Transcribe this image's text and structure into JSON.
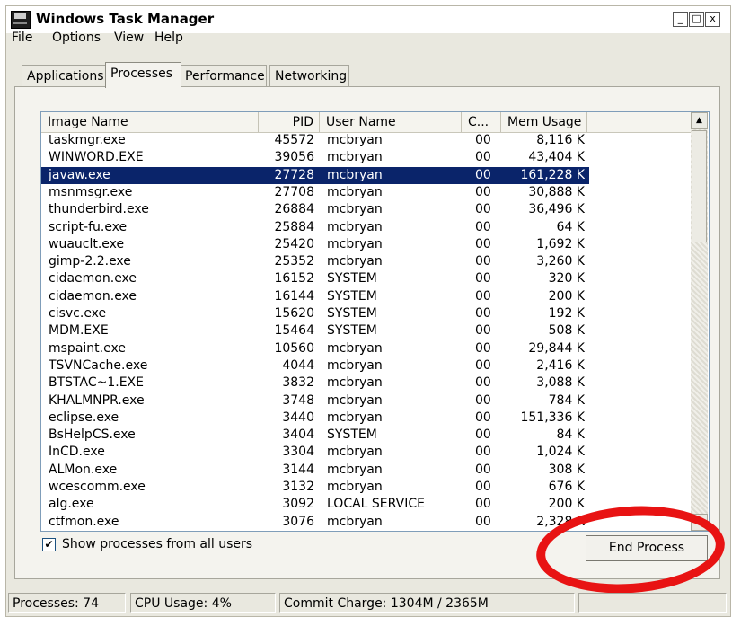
{
  "window": {
    "title": "Windows Task Manager"
  },
  "titlebar": {
    "min_label": "_",
    "max_label": "□",
    "close_label": "x"
  },
  "menu": {
    "items": [
      "File",
      "Options",
      "View",
      "Help"
    ]
  },
  "tabs": [
    {
      "label": "Applications",
      "active": false
    },
    {
      "label": "Processes",
      "active": true
    },
    {
      "label": "Performance",
      "active": false
    },
    {
      "label": "Networking",
      "active": false
    }
  ],
  "table": {
    "headers": [
      "Image Name",
      "PID",
      "User Name",
      "C...",
      "Mem Usage"
    ],
    "rows": [
      {
        "name": "taskmgr.exe",
        "pid": "45572",
        "user": "mcbryan",
        "cpu": "00",
        "mem": "8,116 K"
      },
      {
        "name": "WINWORD.EXE",
        "pid": "39056",
        "user": "mcbryan",
        "cpu": "00",
        "mem": "43,404 K"
      },
      {
        "name": "javaw.exe",
        "pid": "27728",
        "user": "mcbryan",
        "cpu": "00",
        "mem": "161,228 K",
        "selected": true
      },
      {
        "name": "msnmsgr.exe",
        "pid": "27708",
        "user": "mcbryan",
        "cpu": "00",
        "mem": "30,888 K"
      },
      {
        "name": "thunderbird.exe",
        "pid": "26884",
        "user": "mcbryan",
        "cpu": "00",
        "mem": "36,496 K"
      },
      {
        "name": "script-fu.exe",
        "pid": "25884",
        "user": "mcbryan",
        "cpu": "00",
        "mem": "64 K"
      },
      {
        "name": "wuauclt.exe",
        "pid": "25420",
        "user": "mcbryan",
        "cpu": "00",
        "mem": "1,692 K"
      },
      {
        "name": "gimp-2.2.exe",
        "pid": "25352",
        "user": "mcbryan",
        "cpu": "00",
        "mem": "3,260 K"
      },
      {
        "name": "cidaemon.exe",
        "pid": "16152",
        "user": "SYSTEM",
        "cpu": "00",
        "mem": "320 K"
      },
      {
        "name": "cidaemon.exe",
        "pid": "16144",
        "user": "SYSTEM",
        "cpu": "00",
        "mem": "200 K"
      },
      {
        "name": "cisvc.exe",
        "pid": "15620",
        "user": "SYSTEM",
        "cpu": "00",
        "mem": "192 K"
      },
      {
        "name": "MDM.EXE",
        "pid": "15464",
        "user": "SYSTEM",
        "cpu": "00",
        "mem": "508 K"
      },
      {
        "name": "mspaint.exe",
        "pid": "10560",
        "user": "mcbryan",
        "cpu": "00",
        "mem": "29,844 K"
      },
      {
        "name": "TSVNCache.exe",
        "pid": "4044",
        "user": "mcbryan",
        "cpu": "00",
        "mem": "2,416 K"
      },
      {
        "name": "BTSTAC~1.EXE",
        "pid": "3832",
        "user": "mcbryan",
        "cpu": "00",
        "mem": "3,088 K"
      },
      {
        "name": "KHALMNPR.exe",
        "pid": "3748",
        "user": "mcbryan",
        "cpu": "00",
        "mem": "784 K"
      },
      {
        "name": "eclipse.exe",
        "pid": "3440",
        "user": "mcbryan",
        "cpu": "00",
        "mem": "151,336 K"
      },
      {
        "name": "BsHelpCS.exe",
        "pid": "3404",
        "user": "SYSTEM",
        "cpu": "00",
        "mem": "84 K"
      },
      {
        "name": "InCD.exe",
        "pid": "3304",
        "user": "mcbryan",
        "cpu": "00",
        "mem": "1,024 K"
      },
      {
        "name": "ALMon.exe",
        "pid": "3144",
        "user": "mcbryan",
        "cpu": "00",
        "mem": "308 K"
      },
      {
        "name": "wcescomm.exe",
        "pid": "3132",
        "user": "mcbryan",
        "cpu": "00",
        "mem": "676 K"
      },
      {
        "name": "alg.exe",
        "pid": "3092",
        "user": "LOCAL SERVICE",
        "cpu": "00",
        "mem": "200 K"
      },
      {
        "name": "ctfmon.exe",
        "pid": "3076",
        "user": "mcbryan",
        "cpu": "00",
        "mem": "2,328 K"
      }
    ]
  },
  "show_all_users": {
    "label": "Show processes from all users",
    "checked": true,
    "check_glyph": "✔"
  },
  "end_process": {
    "label": "End Process"
  },
  "status": {
    "processes": "Processes: 74",
    "cpu": "CPU Usage: 4%",
    "commit": "Commit Charge: 1304M / 2365M"
  },
  "colors": {
    "selection": "#0a246a",
    "annotation_circle": "#e81313"
  }
}
